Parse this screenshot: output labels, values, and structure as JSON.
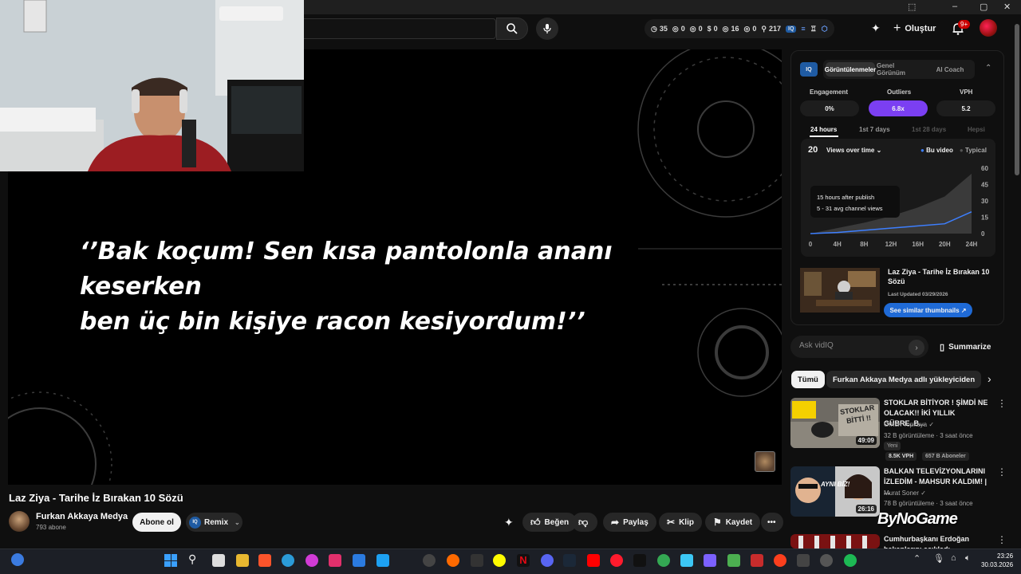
{
  "browser": {
    "window_controls": [
      "–",
      "▢",
      "✕"
    ]
  },
  "header": {
    "stats": [
      {
        "icon": "clock-icon",
        "value": "35"
      },
      {
        "icon": "eye-icon",
        "value": "0"
      },
      {
        "icon": "eye-icon",
        "value": "0"
      },
      {
        "icon": "dollar-icon",
        "value": "0"
      },
      {
        "icon": "eye-icon",
        "value": "16"
      },
      {
        "icon": "eye-icon",
        "value": "0"
      },
      {
        "icon": "user-icon",
        "value": "217"
      }
    ],
    "create_label": "Oluştur",
    "notification_count": "9+"
  },
  "video": {
    "quote_line1": "‘’Bak koçum! Sen kısa pantolonla ananı keserken",
    "quote_line2": "ben üç bin kişiye racon kesiyordum!’’",
    "title": "Laz Ziya - Tarihe İz Bırakan 10 Sözü"
  },
  "channel": {
    "name": "Furkan Akkaya Medya",
    "subscribers": "793 abone",
    "subscribe_label": "Abone ol",
    "remix_label": "Remix"
  },
  "actions": {
    "like": "Beğen",
    "share": "Paylaş",
    "clip": "Klip",
    "save": "Kaydet"
  },
  "vidiq": {
    "logo": "IQ",
    "tabs": [
      "Görüntülenmeler",
      "Genel Görünüm",
      "AI Coach"
    ],
    "active_tab": 0,
    "metrics": [
      {
        "label": "Engagement",
        "value": "0%"
      },
      {
        "label": "Outliers",
        "value": "6.8x"
      },
      {
        "label": "VPH",
        "value": "5.2"
      }
    ],
    "periods": [
      "24 hours",
      "1st 7 days",
      "1st 28 days",
      "Hepsi"
    ],
    "active_period": 0,
    "views_count": "20",
    "views_dropdown": "Views over time",
    "legend": [
      "Bu video",
      "Typical"
    ],
    "colors": {
      "this_video": "#3d7fff",
      "typical": "#555555",
      "outlier": "#7b3ff2",
      "see_similar": "#1f6ad6"
    },
    "tooltip_line1": "15 hours after publish",
    "tooltip_line2": "5 - 31 avg channel views",
    "thumb_title": "Laz Ziya - Tarihe İz Bırakan 10 Sözü",
    "last_updated": "Last Updated 03/29/2026",
    "see_similar": "See similar thumbnails ↗",
    "ask_placeholder": "Ask vidIQ",
    "summarize": "Summarize"
  },
  "chart_data": {
    "type": "area",
    "x": [
      "0",
      "4H",
      "8H",
      "12H",
      "16H",
      "20H",
      "24H"
    ],
    "y_ticks": [
      0,
      15,
      30,
      45,
      60
    ],
    "ylim": [
      0,
      60
    ],
    "series": [
      {
        "name": "Bu video",
        "values": [
          0,
          1,
          3,
          5,
          7,
          9,
          20
        ]
      },
      {
        "name": "Typical",
        "values": [
          0,
          5,
          10,
          16,
          24,
          34,
          55
        ]
      }
    ],
    "legend": "top-right"
  },
  "chips": [
    "Tümü",
    "Furkan Akkaya Medya adlı yükleyiciden"
  ],
  "recommendations": [
    {
      "title": "STOKLAR BİTİYOR ! ŞİMDİ NE OLACAK!! İKİ YILLIK GÜBRE..B...",
      "channel": "Orhun Topkaya",
      "meta": "32 B görüntüleme · 3 saat önce",
      "badge": "Yeni",
      "vph": "8.5K VPH",
      "subs": "657 B Aboneler",
      "duration": "49:09",
      "thumb_text1": "STOKLAR",
      "thumb_text2": "BİTTİ !!"
    },
    {
      "title": "BALKAN TELEVİZYONLARINI İZLEDİM - MAHSUR KALDIM! | ...",
      "channel": "Murat Soner",
      "meta": "78 B görüntüleme · 3 saat önce",
      "duration": "26:16",
      "thumb_text1": "AYNI BİZ!"
    },
    {
      "title": "Cumhurbaşkanı Erdoğan",
      "title2": "bakanlarını açıkladı"
    }
  ],
  "watermark": "ByNoGame",
  "taskbar": {
    "time": "23:26",
    "date": "30.03.2026"
  }
}
